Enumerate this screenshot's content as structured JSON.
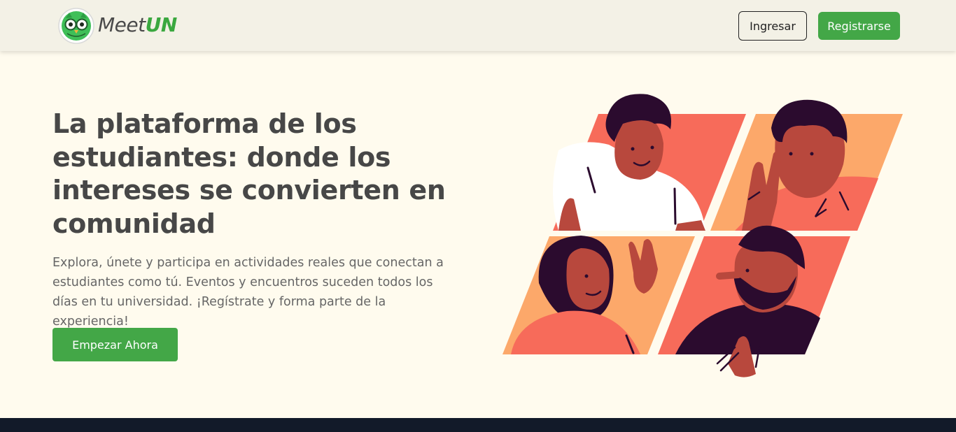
{
  "brand": {
    "name_part1": "Meet",
    "name_part2": "UN",
    "logo_icon": "owl-icon",
    "colors": {
      "primary_green": "#43a747",
      "text_dark": "#474747",
      "background": "#fffbee",
      "footer": "#121a29"
    }
  },
  "nav": {
    "login_label": "Ingresar",
    "register_label": "Registrarse"
  },
  "hero": {
    "title": "La plataforma de los estudiantes: donde los intereses se convierten en comunidad",
    "subtitle": "Explora, únete y participa en actividades reales que conectan a estudiantes como tú. Eventos y encuentros suceden todos los días en tu universidad. ¡Regístrate y forma parte de la experiencia!",
    "cta_label": "Empezar Ahora",
    "illustration_icon": "video-call-students-illustration"
  }
}
